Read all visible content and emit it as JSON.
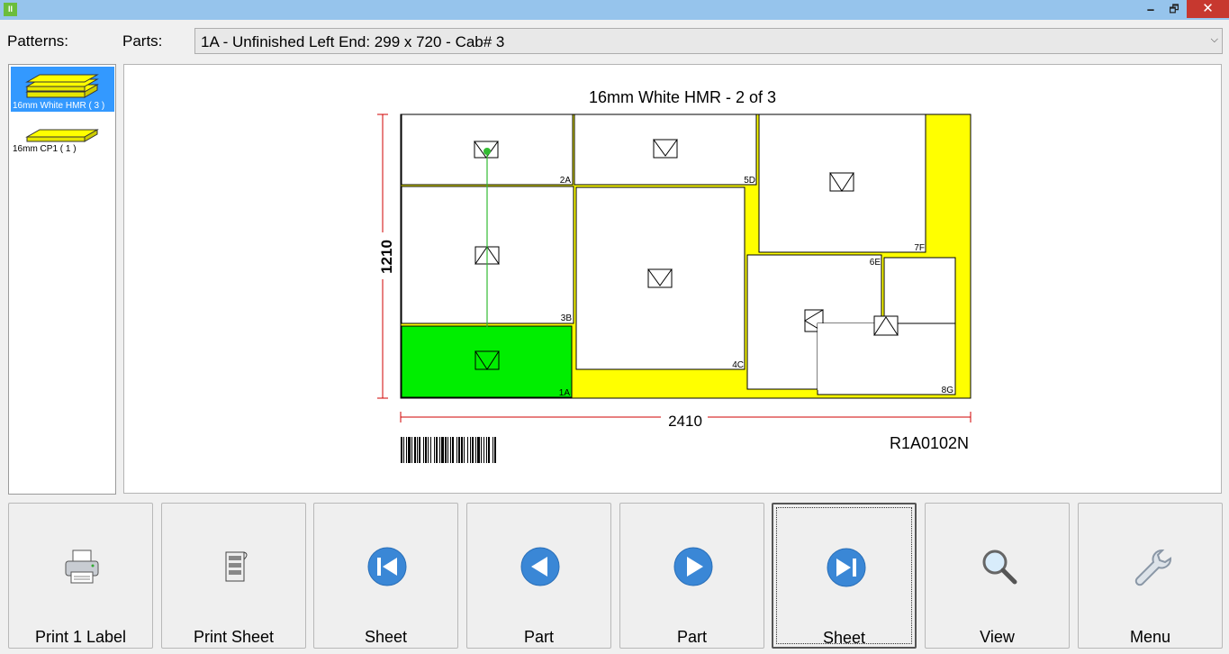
{
  "window": {
    "minimize": "🗕",
    "maximize": "🗗",
    "close": "✕"
  },
  "labels": {
    "patterns": "Patterns:",
    "parts": "Parts:"
  },
  "parts_combo": {
    "value": "1A  - Unfinished Left End: 299 x 720 - Cab# 3"
  },
  "patterns": [
    {
      "label": "16mm White HMR  ( 3 )",
      "selected": true,
      "icon": "stacked-boards-icon"
    },
    {
      "label": "16mm CP1  ( 1 )",
      "selected": false,
      "icon": "single-board-icon"
    }
  ],
  "sheet": {
    "title": "16mm White HMR - 2 of 3",
    "width_dim": "2410",
    "height_dim": "1210",
    "barcode_text": "R1A0102N",
    "waste_color": "#ffff00",
    "selected_color": "#00ee00",
    "dim_color": "#d00000",
    "parts": [
      {
        "id": "2A",
        "selected": false
      },
      {
        "id": "5D",
        "selected": false
      },
      {
        "id": "7F",
        "selected": false
      },
      {
        "id": "3B",
        "selected": false
      },
      {
        "id": "4C",
        "selected": false
      },
      {
        "id": "6E",
        "selected": false
      },
      {
        "id": "8G",
        "selected": false
      },
      {
        "id": "1A",
        "selected": true
      }
    ]
  },
  "buttons": [
    {
      "label": "Print 1 Label",
      "icon": "printer-icon"
    },
    {
      "label": "Print Sheet",
      "icon": "print-sheet-icon"
    },
    {
      "label": "Sheet",
      "icon": "first-sheet-icon"
    },
    {
      "label": "Part",
      "icon": "previous-part-icon"
    },
    {
      "label": "Part",
      "icon": "next-part-icon"
    },
    {
      "label": "Sheet",
      "icon": "last-sheet-icon",
      "focused": true
    },
    {
      "label": "View",
      "icon": "magnifier-icon"
    },
    {
      "label": "Menu",
      "icon": "wrench-icon"
    }
  ]
}
